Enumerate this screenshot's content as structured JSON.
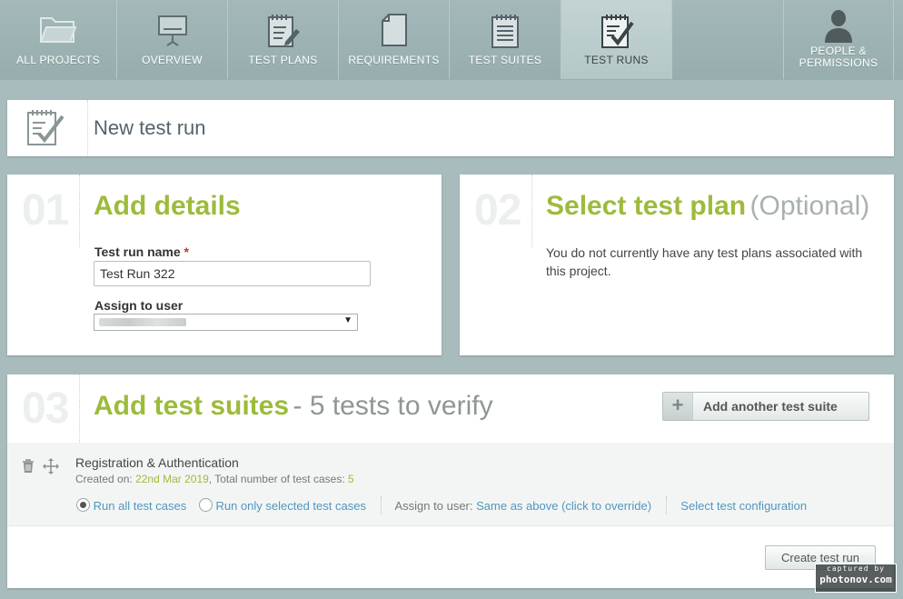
{
  "nav": {
    "tabs": [
      {
        "label": "ALL PROJECTS",
        "icon": "folder-icon"
      },
      {
        "label": "OVERVIEW",
        "icon": "presentation-icon"
      },
      {
        "label": "TEST PLANS",
        "icon": "notepad-pencil-icon"
      },
      {
        "label": "REQUIREMENTS",
        "icon": "document-icon"
      },
      {
        "label": "TEST SUITES",
        "icon": "list-notepad-icon"
      },
      {
        "label": "TEST RUNS",
        "icon": "checklist-icon",
        "active": true
      },
      {
        "label": "PEOPLE & PERMISSIONS",
        "icon": "person-icon"
      }
    ]
  },
  "page": {
    "title": "New test run",
    "icon": "checklist-icon"
  },
  "step1": {
    "number": "01",
    "heading": "Add details",
    "name_label": "Test run name",
    "required_mark": "*",
    "name_value": "Test Run 322",
    "assign_label": "Assign to user",
    "assign_arrow": "▼"
  },
  "step2": {
    "number": "02",
    "heading": "Select test plan",
    "optional": "(Optional)",
    "message": "You do not currently have any test plans associated with this project."
  },
  "step3": {
    "number": "03",
    "heading": "Add test suites",
    "subheading": "- 5 tests to verify",
    "add_button": "Add another test suite",
    "suite": {
      "name": "Registration & Authentication",
      "created_label": "Created on:",
      "created_date": "22nd Mar 2019",
      "total_label": ", Total number of test cases:",
      "total_count": "5",
      "run_all": "Run all test cases",
      "run_selected": "Run only selected test cases",
      "assign_label": "Assign to user:",
      "assign_link": "Same as above (click to override)",
      "config_link": "Select test configuration"
    }
  },
  "footer": {
    "create_button": "Create test run"
  },
  "watermark": {
    "line1": "captured by",
    "line2": "photonov.com"
  },
  "colors": {
    "accent_green": "#9dbb3b",
    "link_blue": "#4f97bf",
    "nav_bg": "#9fb3b4"
  }
}
